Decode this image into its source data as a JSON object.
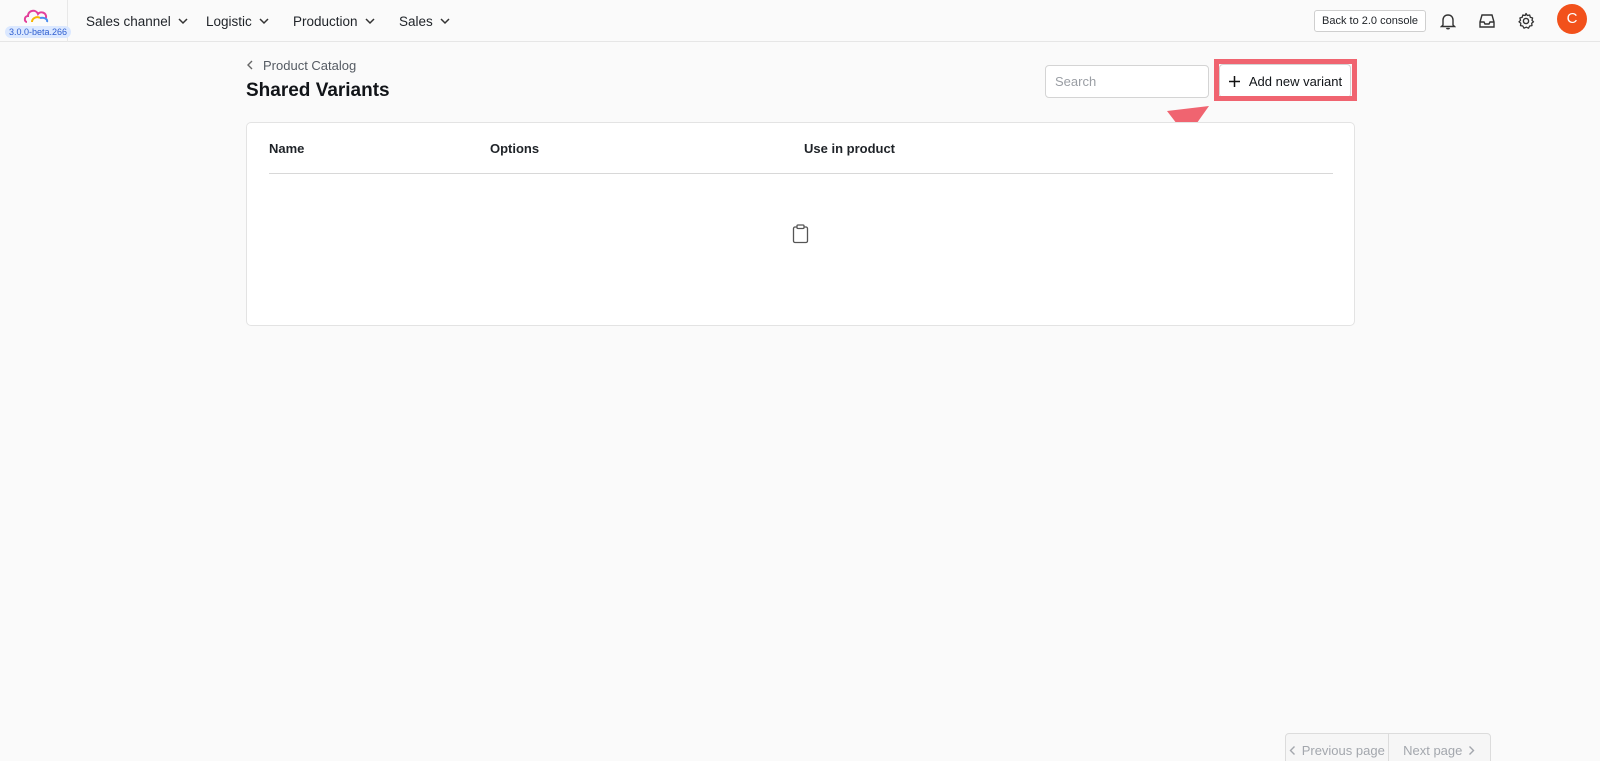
{
  "app": {
    "version": "3.0.0-beta.266",
    "brand_colors": [
      "#f2511b",
      "#f7b500",
      "#4a8df0",
      "#e23f9a"
    ]
  },
  "nav": {
    "items": [
      {
        "label": "Sales channel"
      },
      {
        "label": "Logistic"
      },
      {
        "label": "Production"
      },
      {
        "label": "Sales"
      }
    ],
    "back_console": "Back to 2.0 console",
    "icons": [
      "bell-icon",
      "inbox-icon",
      "gear-icon"
    ],
    "avatar_initial": "C",
    "avatar_color": "#f2511b"
  },
  "page": {
    "breadcrumb": "Product Catalog",
    "title": "Shared Variants",
    "search_placeholder": "Search",
    "search_value": "",
    "add_button": "Add new variant"
  },
  "table": {
    "columns": [
      "Name",
      "Options",
      "Use in product"
    ],
    "rows": [],
    "empty_icon": "clipboard-icon"
  },
  "pagination": {
    "previous": "Previous page",
    "next": "Next page"
  },
  "annotation": {
    "color": "#f06470",
    "target": "add-new-variant-button"
  }
}
